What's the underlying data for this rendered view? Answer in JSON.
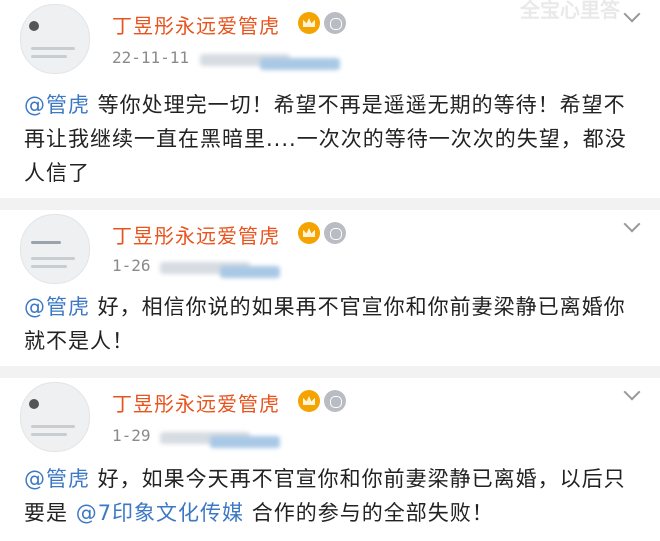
{
  "watermark": "全宝心里答",
  "posts": [
    {
      "author": "丁昱彤永远爱管虎",
      "time": "22-11-11",
      "mention": "@管虎",
      "text": " 等你处理完一切！希望不再是遥遥无期的等待！希望不再让我继续一直在黑暗里....一次次的等待一次次的失望，都没人信了",
      "more_icon": "chevron-down-icon"
    },
    {
      "author": "丁昱彤永远爱管虎",
      "time": "1-26",
      "mention": "@管虎",
      "text": " 好，相信你说的如果再不官宣你和你前妻梁静已离婚你就不是人！",
      "more_icon": "chevron-down-icon"
    },
    {
      "author": "丁昱彤永远爱管虎",
      "time": "1-29",
      "mention": "@管虎",
      "text": " 好，如果今天再不官宣你和你前妻梁静已离婚，以后只要是 ",
      "mention2": "@7印象文化传媒",
      "text2": " 合作的参与的全部失败！",
      "more_icon": "chevron-down-icon"
    }
  ],
  "colors": {
    "name": "#e8541e",
    "mention": "#3d78c4",
    "text": "#222222",
    "time": "#8a8a8a"
  }
}
